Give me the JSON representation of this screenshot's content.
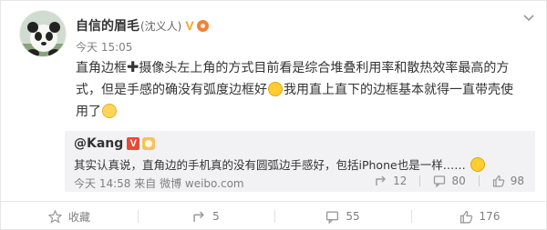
{
  "post": {
    "author": {
      "name": "自信的眉毛",
      "remark": "(沈义人)",
      "vip_badge": "V"
    },
    "time": "今天 15:05",
    "content": {
      "part1": "直角边框",
      "part2": "摄像头左上角的方式目前看是综合堆叠利用率和散热效率最高的方式，但是手感的确没有弧度边框好",
      "part3": "我用直上直下的边框基本就得一直带壳使用了"
    },
    "repost": {
      "author": "@Kang",
      "vip_badge": "V",
      "text": "其实认真说，直角边的手机真的没有圆弧边手感好，包括iPhone也是一样……",
      "time": "今天 14:58",
      "source_prefix": "来自",
      "source": "微博 weibo.com",
      "share_count": "12",
      "comment_count": "80",
      "like_count": "98"
    },
    "bottom_bar": {
      "favorite_label": "收藏",
      "share_count": "5",
      "comment_count": "55",
      "like_count": "176"
    }
  },
  "icons": {
    "avatar": "panda-avatar",
    "menu": "chevron-down-icon",
    "share": "share-icon",
    "comment": "comment-icon",
    "like": "thumbs-up-icon",
    "favorite": "star-icon"
  },
  "colors": {
    "vip_gold": "#f5a623",
    "vip_red": "#e84a3a",
    "repost_bg": "#f2f2f5",
    "meta_gray": "#808080"
  }
}
